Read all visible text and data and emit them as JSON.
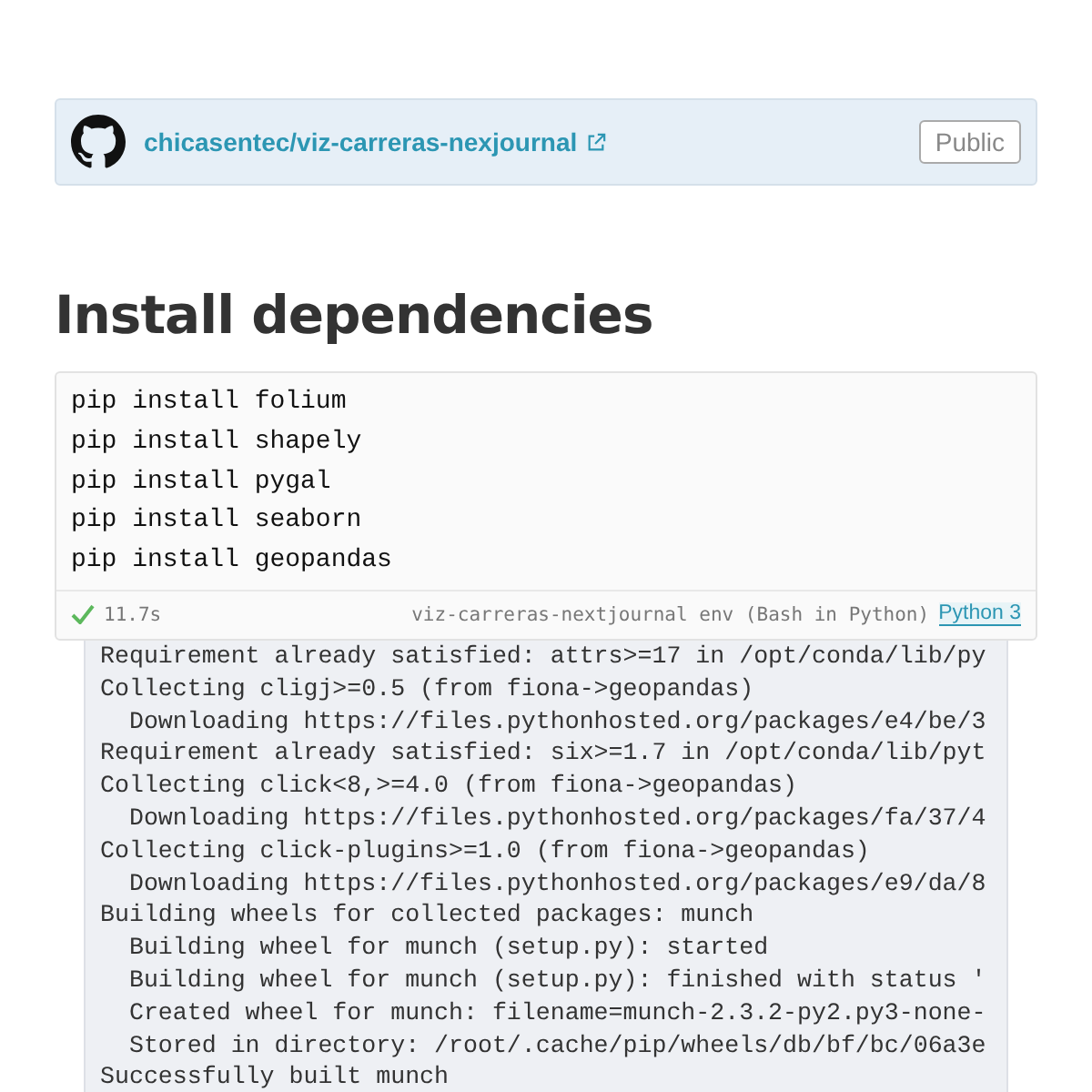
{
  "repo": {
    "name": "chicasentec/viz-carreras-nexjournal",
    "visibility": "Public"
  },
  "heading": "Install dependencies",
  "cell": {
    "code": [
      "pip install folium",
      "pip install shapely",
      "pip install pygal",
      "pip install seaborn",
      "pip install geopandas"
    ],
    "succeeded": true,
    "duration": "11.7s",
    "environment": "viz-carreras-nextjournal env (Bash in Python)",
    "language": "Python 3"
  },
  "output": {
    "lines": [
      "Requirement already satisfied: attrs>=17 in /opt/conda/lib/py",
      "Collecting cligj>=0.5 (from fiona->geopandas)",
      "  Downloading https://files.pythonhosted.org/packages/e4/be/3",
      "Requirement already satisfied: six>=1.7 in /opt/conda/lib/pyt",
      "Collecting click<8,>=4.0 (from fiona->geopandas)",
      "  Downloading https://files.pythonhosted.org/packages/fa/37/4",
      "Collecting click-plugins>=1.0 (from fiona->geopandas)",
      "  Downloading https://files.pythonhosted.org/packages/e9/da/8",
      "Building wheels for collected packages: munch",
      "  Building wheel for munch (setup.py): started",
      "  Building wheel for munch (setup.py): finished with status '",
      "  Created wheel for munch: filename=munch-2.3.2-py2.py3-none-",
      "  Stored in directory: /root/.cache/pip/wheels/db/bf/bc/06a3e",
      "Successfully built munch"
    ]
  }
}
